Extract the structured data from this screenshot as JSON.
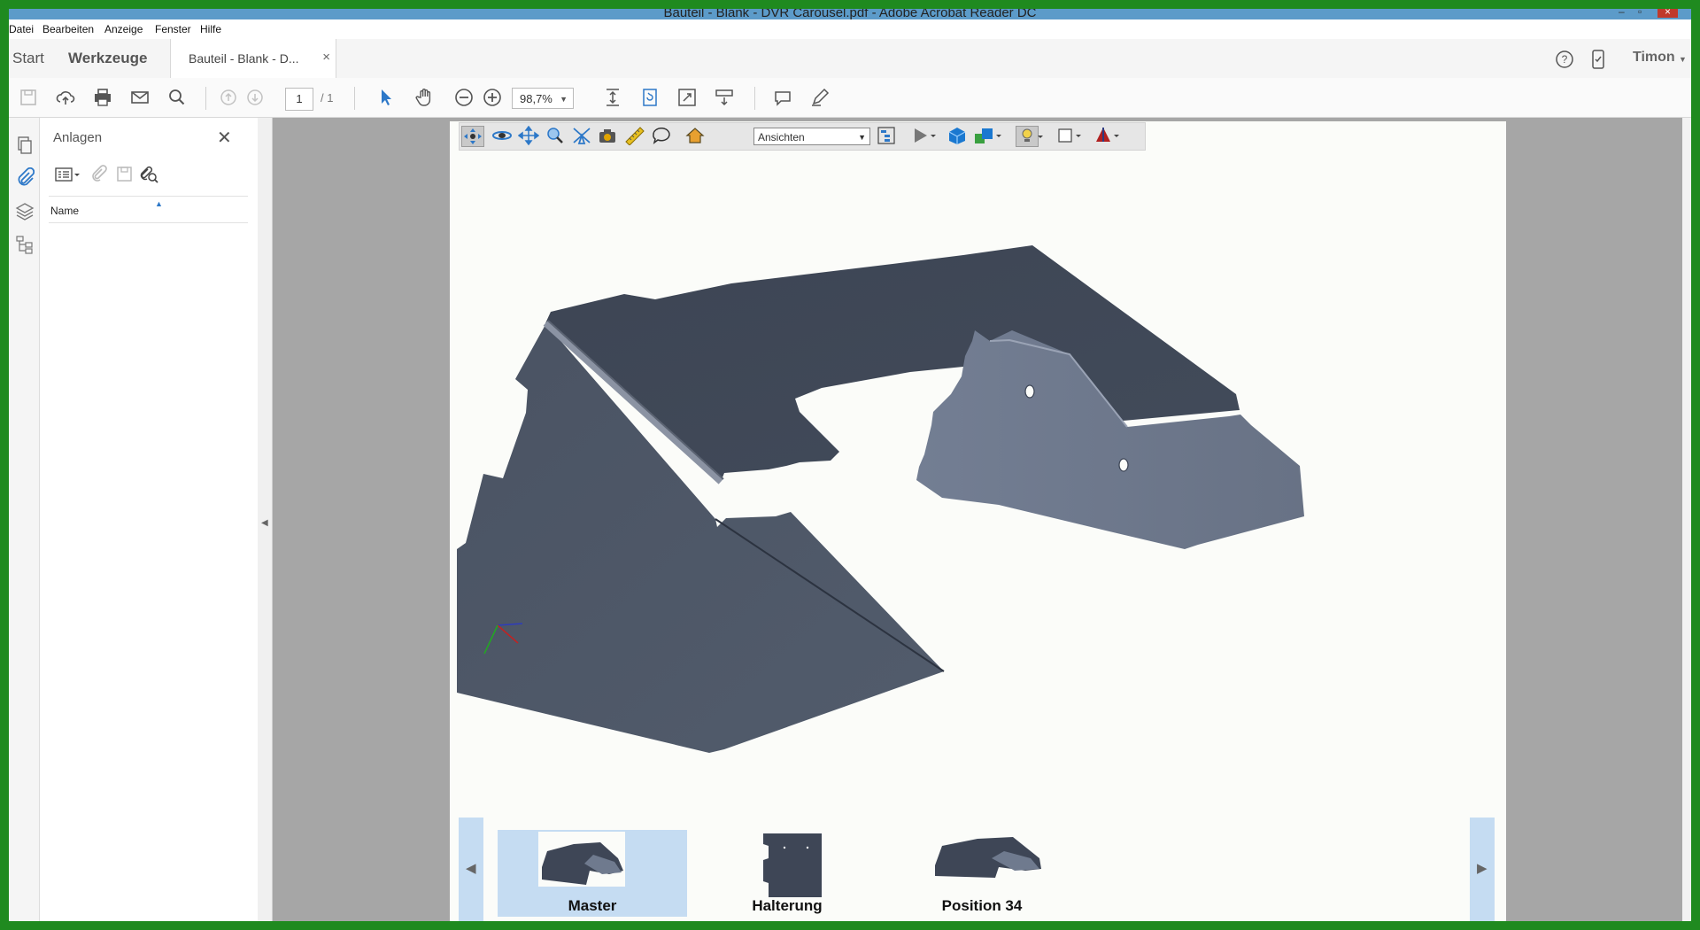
{
  "window": {
    "title": "Bauteil - Blank - DVR Carousel.pdf - Adobe Acrobat Reader DC"
  },
  "menu": [
    "Datei",
    "Bearbeiten",
    "Anzeige",
    "Fenster",
    "Hilfe"
  ],
  "tabs": {
    "start": "Start",
    "tools": "Werkzeuge",
    "document": "Bauteil - Blank - D...",
    "close": "×"
  },
  "user": {
    "name": "Timon"
  },
  "toolbar": {
    "page_current": "1",
    "page_total": "/ 1",
    "zoom": "98,7%"
  },
  "attachments_panel": {
    "title": "Anlagen",
    "column_name": "Name"
  },
  "viewer3d": {
    "views_dropdown": "Ansichten"
  },
  "carousel": {
    "items": [
      "Master",
      "Halterung",
      "Position 34"
    ],
    "selected": "Master"
  },
  "colors": {
    "accent": "#2d78c8",
    "model": "#545e6e",
    "panel_bg": "#c5dcf2",
    "doc_bg": "#a6a6a6",
    "outer_frame": "#1f8a1f"
  },
  "icons": {
    "toolbar": [
      "save-icon",
      "cloud-upload-icon",
      "print-icon",
      "mail-icon",
      "search-icon",
      "prev-page-icon",
      "next-page-icon",
      "select-arrow-icon",
      "hand-icon",
      "zoom-out-icon",
      "zoom-in-icon",
      "fit-page-icon",
      "rotate-icon",
      "fullscreen-icon",
      "scroll-mode-icon",
      "comment-icon",
      "sign-icon"
    ],
    "rail": [
      "pages-icon",
      "attachments-icon",
      "layers-icon",
      "model-tree-icon"
    ],
    "viewer3d": [
      "rotate-3d-icon",
      "spin-icon",
      "pan-icon",
      "zoom-3d-icon",
      "fly-icon",
      "camera-icon",
      "measure-icon",
      "comment-3d-icon",
      "home-icon",
      "model-tree-toggle-icon",
      "play-animation-icon",
      "render-mode-icon",
      "projection-icon",
      "lighting-icon",
      "background-color-icon",
      "cross-section-icon"
    ]
  }
}
